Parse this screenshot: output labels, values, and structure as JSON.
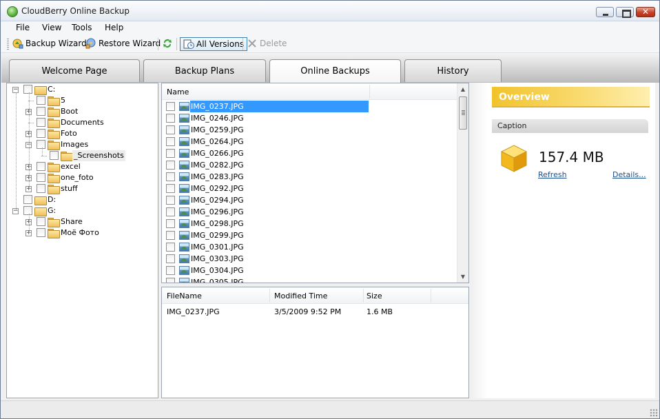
{
  "window": {
    "title": "CloudBerry Online Backup",
    "close_glyph": "✕"
  },
  "menu": [
    "File",
    "View",
    "Tools",
    "Help"
  ],
  "toolbar": {
    "backup_wizard": "Backup Wizard",
    "restore_wizard": "Restore Wizard",
    "all_versions": "All Versions",
    "delete": "Delete"
  },
  "tabs": [
    "Welcome Page",
    "Backup Plans",
    "Online Backups",
    "History"
  ],
  "active_tab": "Online Backups",
  "tree": {
    "nodes": [
      {
        "label": "C:",
        "type": "drive",
        "level": 0,
        "expander": "minus"
      },
      {
        "label": "5",
        "type": "folder",
        "level": 1,
        "expander": "none"
      },
      {
        "label": "Boot",
        "type": "folder",
        "level": 1,
        "expander": "plus"
      },
      {
        "label": "Documents",
        "type": "folder",
        "level": 1,
        "expander": "none"
      },
      {
        "label": "Foto",
        "type": "folder",
        "level": 1,
        "expander": "plus"
      },
      {
        "label": "Images",
        "type": "folder",
        "level": 1,
        "expander": "minus"
      },
      {
        "label": "_Screenshots",
        "type": "folder",
        "level": 2,
        "expander": "none",
        "selected": true
      },
      {
        "label": "excel",
        "type": "folder",
        "level": 1,
        "expander": "plus"
      },
      {
        "label": "one_foto",
        "type": "folder",
        "level": 1,
        "expander": "plus"
      },
      {
        "label": "stuff",
        "type": "folder",
        "level": 1,
        "expander": "plus"
      },
      {
        "label": "D:",
        "type": "drive",
        "level": 0,
        "expander": "none"
      },
      {
        "label": "G:",
        "type": "drive",
        "level": 0,
        "expander": "minus"
      },
      {
        "label": "Share",
        "type": "folder",
        "level": 1,
        "expander": "plus"
      },
      {
        "label": "Моё Фото",
        "type": "folder",
        "level": 1,
        "expander": "plus"
      }
    ]
  },
  "filelist": {
    "header": "Name",
    "files": [
      "IMG_0237.JPG",
      "IMG_0246.JPG",
      "IMG_0259.JPG",
      "IMG_0264.JPG",
      "IMG_0266.JPG",
      "IMG_0282.JPG",
      "IMG_0283.JPG",
      "IMG_0292.JPG",
      "IMG_0294.JPG",
      "IMG_0296.JPG",
      "IMG_0298.JPG",
      "IMG_0299.JPG",
      "IMG_0301.JPG",
      "IMG_0303.JPG",
      "IMG_0304.JPG",
      "IMG_0305.JPG"
    ],
    "selected_index": 0,
    "scroll_up": "▲",
    "scroll_down": "▼"
  },
  "details": {
    "headers": {
      "filename": "FileName",
      "modified": "Modified Time",
      "size": "Size"
    },
    "row": {
      "filename": "IMG_0237.JPG",
      "modified": "3/5/2009 9:52 PM",
      "size": "1.6 MB"
    }
  },
  "overview": {
    "title": "Overview",
    "caption": "Caption",
    "size": "157.4 MB",
    "refresh": "Refresh",
    "details_link": "Details..."
  },
  "colors": {
    "selection": "#3399ff",
    "overview_accent": "#f1c32c",
    "link": "#1a4e8c"
  }
}
